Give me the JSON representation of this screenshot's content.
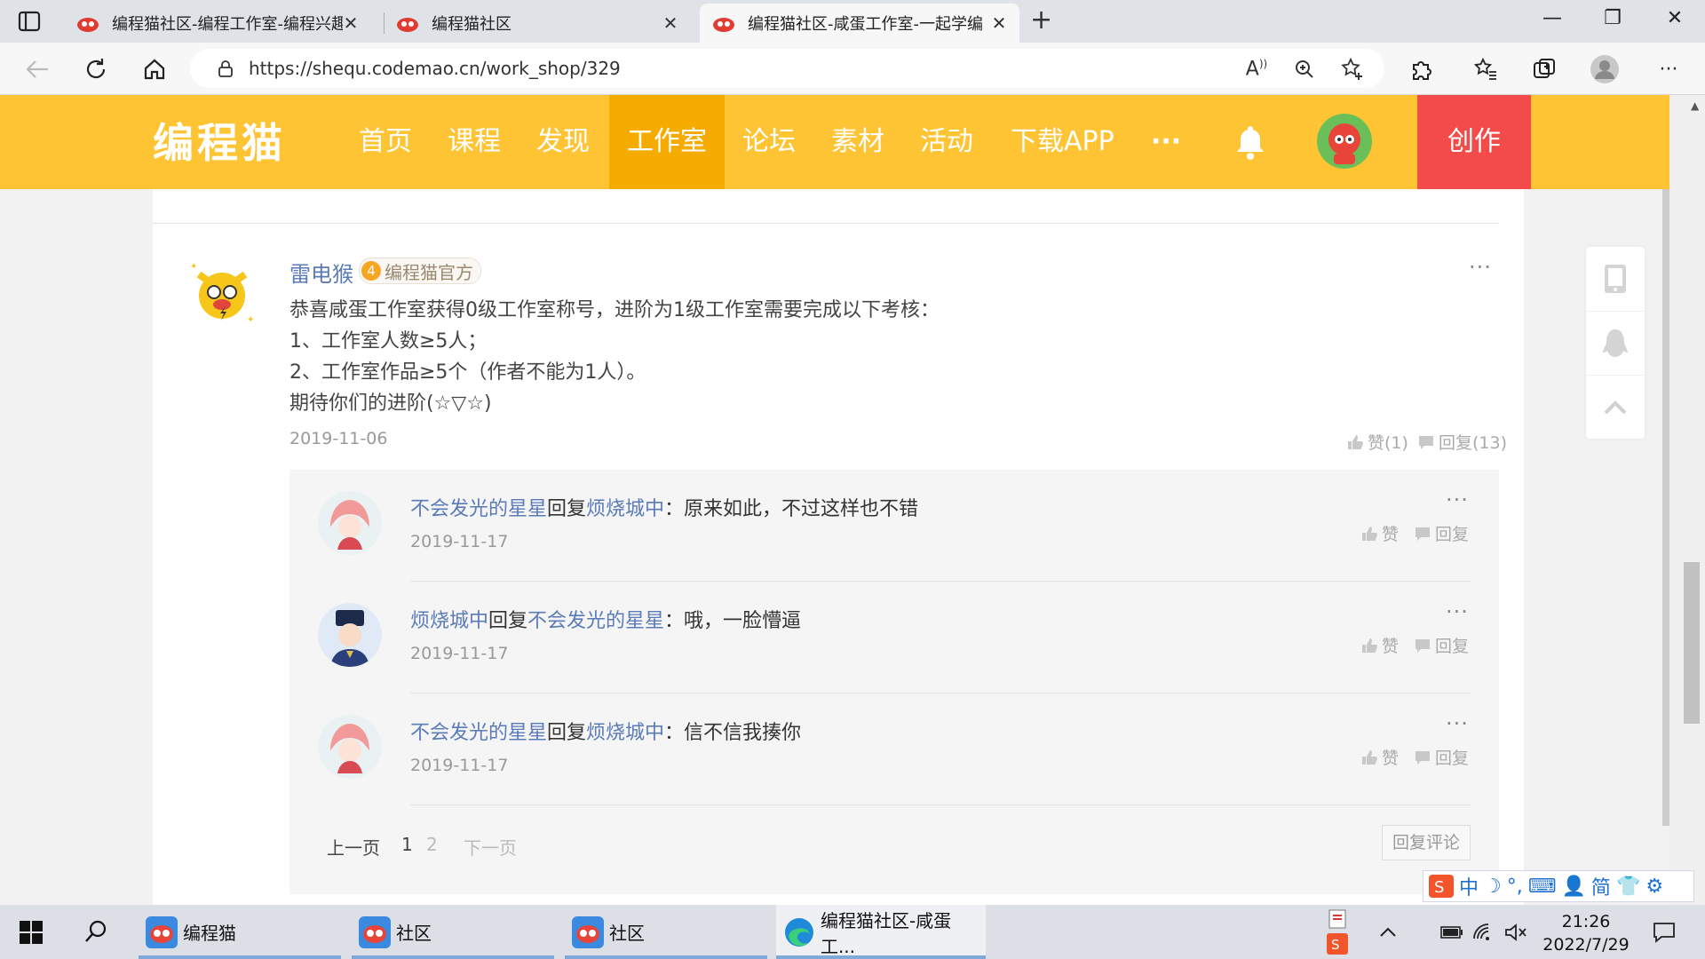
{
  "browser": {
    "tabs": [
      {
        "title": "编程猫社区-编程工作室-编程兴趣",
        "active": false
      },
      {
        "title": "编程猫社区",
        "active": false
      },
      {
        "title": "编程猫社区-咸蛋工作室-一起学编",
        "active": true
      }
    ],
    "url": "https://shequ.codemao.cn/work_shop/329"
  },
  "site": {
    "logo": "编程猫",
    "nav": [
      "首页",
      "课程",
      "发现",
      "工作室",
      "论坛",
      "素材",
      "活动",
      "下载APP",
      "···"
    ],
    "active_nav": "工作室",
    "create_label": "创作",
    "colors": {
      "header": "#fec433",
      "active_nav": "#f5ab00",
      "create": "#f24b49",
      "link": "#5a7ab8"
    }
  },
  "post": {
    "author": "雷电猴",
    "level": "4",
    "badge": "编程猫官方",
    "lines": [
      "恭喜咸蛋工作室获得0级工作室称号，进阶为1级工作室需要完成以下考核：",
      "1、工作室人数≥5人；",
      "2、工作室作品≥5个（作者不能为1人）。",
      "期待你们的进阶(☆▽☆)"
    ],
    "date": "2019-11-06",
    "like_label": "赞(1)",
    "reply_label": "回复(13)",
    "more": "···"
  },
  "replies": [
    {
      "from": "不会发光的星星",
      "reply_word": "回复",
      "to": "烦烧城中",
      "text": "：原来如此，不过这样也不错",
      "date": "2019-11-17",
      "like": "赞",
      "reply": "回复"
    },
    {
      "from": "烦烧城中",
      "reply_word": "回复",
      "to": "不会发光的星星",
      "text": "：哦，一脸懵逼",
      "date": "2019-11-17",
      "like": "赞",
      "reply": "回复"
    },
    {
      "from": "不会发光的星星",
      "reply_word": "回复",
      "to": "烦烧城中",
      "text": "：信不信我揍你",
      "date": "2019-11-17",
      "like": "赞",
      "reply": "回复"
    }
  ],
  "pager": {
    "prev": "上一页",
    "pages": [
      "1",
      "2"
    ],
    "current": "1",
    "next": "下一页"
  },
  "reply_comment_button": "回复评论",
  "ime": {
    "lang": "中",
    "simplified": "简"
  },
  "taskbar": {
    "apps": [
      {
        "label": "编程猫"
      },
      {
        "label": "社区"
      },
      {
        "label": "社区"
      },
      {
        "label": "编程猫社区-咸蛋工..."
      }
    ],
    "time": "21:26",
    "date": "2022/7/29"
  }
}
